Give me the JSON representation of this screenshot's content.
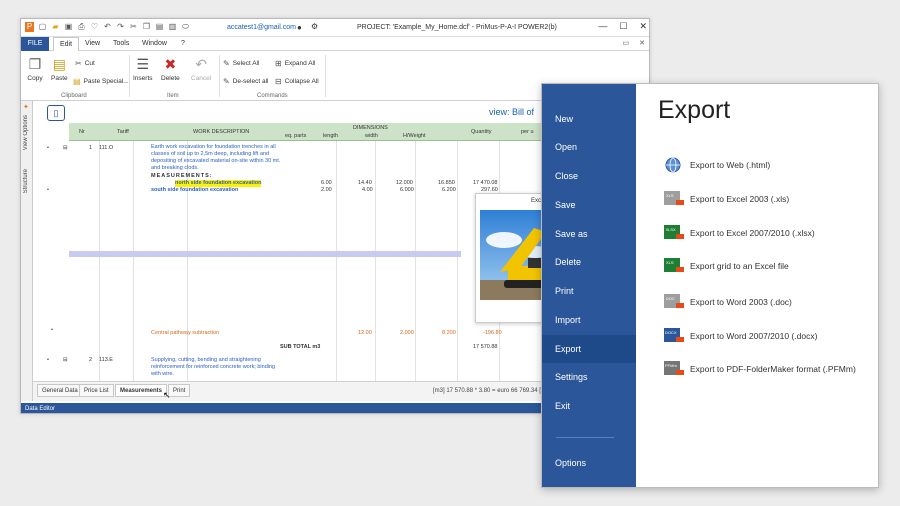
{
  "titlebar": {
    "email": "accatest1@gmail.com",
    "title": "PROJECT: 'Example_My_Home.dcf' - PriMus-P-A-I   POWER2(b)",
    "win_min": "—",
    "win_max": "☐",
    "win_close": "✕"
  },
  "menubar": {
    "file": "FILE",
    "tabs": [
      "Edit",
      "View",
      "Tools",
      "Window",
      "?"
    ]
  },
  "ribbon": {
    "copy": "Copy",
    "paste": "Paste",
    "cut": "Cut",
    "paste_special": "Paste Special...",
    "inserts": "Inserts",
    "delete": "Delete",
    "cancel": "Cancel",
    "select_all": "Select All",
    "deselect_all": "De-select all",
    "expand_all": "Expand All",
    "collapse_all": "Collapse All",
    "group_clipboard": "Clipboard",
    "group_item": "Item",
    "group_commands": "Commands"
  },
  "sidebar": {
    "view_options": "View Options",
    "structure": "Structure"
  },
  "content": {
    "view_label": "view:  Bill of",
    "headers": {
      "nr": "Nr",
      "tariff": "Tariff",
      "work_description": "WORK DESCRIPTION",
      "dimensions": "DIMENSIONS",
      "eq_parts": "eq. parts",
      "length": "length",
      "width": "width",
      "h_weight": "H/Weight",
      "quantity": "Quantity",
      "per_unit": "per u"
    },
    "item1": {
      "row": "1",
      "tariff": "111.O",
      "desc": [
        "Earth work excavation for foundation trenches in all",
        "classes of soil up to 2,5m deep, including lift and",
        "depositing of excavated material on-site within 30 mt.",
        "and breaking clods."
      ],
      "measurements": "MEASUREMENTS:",
      "north": "north side foundation excavation",
      "south": "south side foundation excavation",
      "eq": [
        "6.00",
        "2.00"
      ],
      "length": [
        "14.40",
        "4.00"
      ],
      "width": [
        "12.000",
        "6.000"
      ],
      "height": [
        "16.850",
        "6.200"
      ],
      "qty": [
        "17 470.08",
        "297.60"
      ]
    },
    "subtraction": {
      "desc": "Central pathway subtraction",
      "length": "12.00",
      "width": "2.000",
      "height": "8.200",
      "qty": "-196.80"
    },
    "subtotal": {
      "label": "SUB TOTAL m3",
      "qty": "17 570.88"
    },
    "item2": {
      "row": "2",
      "tariff": "113.E",
      "desc": [
        "Supplying, cutting, bending and straightening",
        "reinforcement for reinforced concrete work; binding",
        "with wire."
      ]
    },
    "tooltip_title": "Excavati"
  },
  "bottom": {
    "tabs": [
      "General Data",
      "Price List",
      "Measurements",
      "Print"
    ],
    "formula": "[m3] 17 570.88 * 3.80 = euro 66 769.34   [16"
  },
  "status": {
    "label": "Data Editor"
  },
  "file_menu": {
    "items": [
      "New",
      "Open",
      "Close",
      "Save",
      "Save as",
      "Delete",
      "Print",
      "Import",
      "Export",
      "Settings",
      "Exit",
      "Options"
    ],
    "active": "Export",
    "title": "Export",
    "exports": [
      {
        "label": "Export to Web (.html)",
        "icon": "globe-icon"
      },
      {
        "label": "Export to Excel 2003 (.xls)",
        "icon": "xls-icon"
      },
      {
        "label": "Export to  Excel 2007/2010 (.xlsx)",
        "icon": "xlsx-icon"
      },
      {
        "label": "Export grid to an Excel file",
        "icon": "xls-grid-icon"
      },
      {
        "label": "Export to Word 2003 (.doc)",
        "icon": "doc-icon"
      },
      {
        "label": "Export to Word 2007/2010 (.docx)",
        "icon": "docx-icon"
      },
      {
        "label": "Export to PDF-FolderMaker format (.PFMm)",
        "icon": "pfm-icon"
      }
    ]
  },
  "colors": {
    "accent": "#2b579a",
    "grid_header": "#cde3c8",
    "highlight": "#fff200"
  }
}
